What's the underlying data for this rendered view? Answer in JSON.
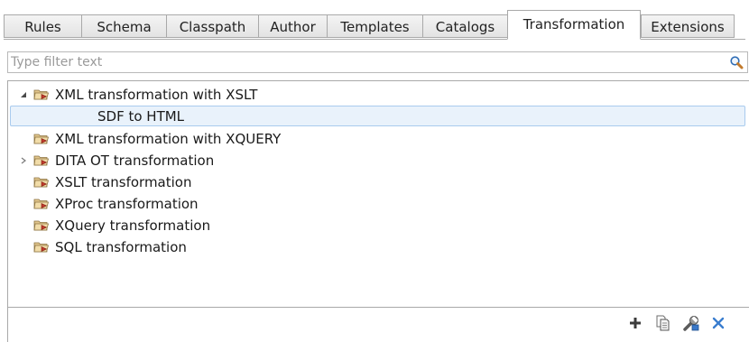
{
  "tabs": [
    {
      "label": "Rules",
      "active": false
    },
    {
      "label": "Schema",
      "active": false
    },
    {
      "label": "Classpath",
      "active": false
    },
    {
      "label": "Author",
      "active": false
    },
    {
      "label": "Templates",
      "active": false
    },
    {
      "label": "Catalogs",
      "active": false
    },
    {
      "label": "Transformation",
      "active": true
    },
    {
      "label": "Extensions",
      "active": false
    }
  ],
  "filter": {
    "placeholder": "Type filter text",
    "value": ""
  },
  "tree": {
    "items": [
      {
        "label": "XML transformation with XSLT",
        "icon": "folder-red-icon",
        "expanded": true
      },
      {
        "label": "SDF to HTML",
        "icon": "none",
        "selected": true
      },
      {
        "label": "XML transformation with XQUERY",
        "icon": "folder-red-icon"
      },
      {
        "label": "DITA OT transformation",
        "icon": "folder-red-icon",
        "collapsed": true
      },
      {
        "label": "XSLT transformation",
        "icon": "folder-red-icon"
      },
      {
        "label": "XProc transformation",
        "icon": "folder-red-icon"
      },
      {
        "label": "XQuery transformation",
        "icon": "folder-red-icon"
      },
      {
        "label": "SQL transformation",
        "icon": "folder-red-icon"
      }
    ]
  },
  "toolbar": {
    "buttons": [
      "add-icon",
      "duplicate-icon",
      "edit-icon",
      "remove-icon"
    ]
  },
  "colors": {
    "selection_bg": "#e9f2fb",
    "selection_border": "#a9cbee",
    "folder_accent": "#c0392b",
    "remove_icon": "#3a7dcf"
  }
}
